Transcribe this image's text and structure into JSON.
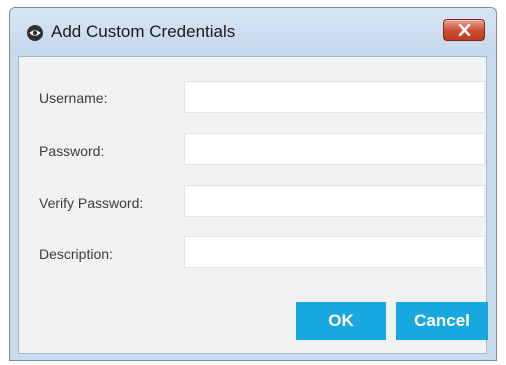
{
  "dialog": {
    "title": "Add Custom Credentials",
    "icon": "eye-icon",
    "close_icon": "close-x-icon",
    "close_color": "#c9452c"
  },
  "form": {
    "fields": [
      {
        "label": "Username:",
        "value": "",
        "placeholder": ""
      },
      {
        "label": "Password:",
        "value": "",
        "placeholder": ""
      },
      {
        "label": "Verify Password:",
        "value": "",
        "placeholder": ""
      },
      {
        "label": "Description:",
        "value": "",
        "placeholder": ""
      }
    ]
  },
  "buttons": {
    "ok_label": "OK",
    "cancel_label": "Cancel",
    "accent_color": "#18a8e0"
  }
}
